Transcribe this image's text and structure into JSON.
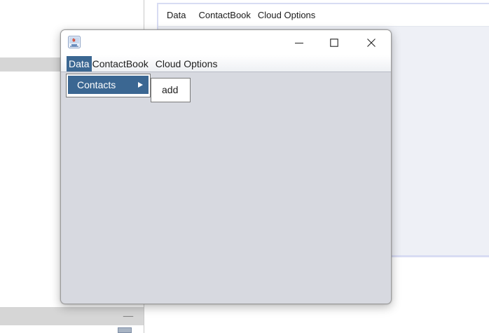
{
  "background_app": {
    "menu": [
      "Data",
      "ContactBook",
      "Cloud Options"
    ]
  },
  "popup_window": {
    "icon": "java-app-icon",
    "controls": {
      "minimize": "minimize-icon",
      "maximize": "maximize-icon",
      "close": "close-icon"
    },
    "menu": {
      "data": "Data",
      "contactbook": "ContactBook",
      "cloud_options": "Cloud Options"
    },
    "dropdown": {
      "contacts": "Contacts"
    },
    "submenu": {
      "add": "add"
    }
  },
  "colors": {
    "selection": "#3b6792",
    "window_bg": "#d7d9e0",
    "menubar_border": "#b7bcc6"
  }
}
